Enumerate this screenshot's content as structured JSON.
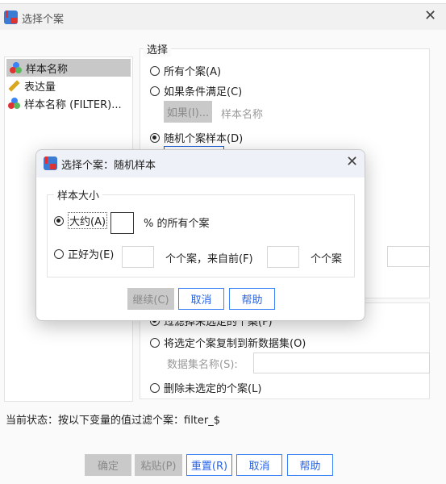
{
  "window": {
    "title": "选择个案"
  },
  "variables": [
    {
      "label": "样本名称",
      "icon": "nominal-icon",
      "selected": true
    },
    {
      "label": "表达量",
      "icon": "scale-ruler-icon",
      "selected": false
    },
    {
      "label": "样本名称 (FILTER)...",
      "icon": "nominal-icon",
      "selected": false
    }
  ],
  "select_group": {
    "label": "选择",
    "all_cases": "所有个案(A)",
    "if_condition": "如果条件满足(C)",
    "if_button": "如果(I)...",
    "if_hint": "样本名称",
    "random_sample": "随机个案样本(D)",
    "selected": "random_sample"
  },
  "output_group": {
    "filter": "过滤掉未选定的个案(F)",
    "copy": "将选定个案复制到新数据集(O)",
    "dataset_label": "数据集名称(S):",
    "dataset_value": "",
    "delete": "删除未选定的个案(L)"
  },
  "status": "当前状态：按以下变量的值过滤个案：filter_$",
  "buttons": {
    "ok": "确定",
    "paste": "粘贴(P)",
    "reset": "重置(R)",
    "cancel": "取消",
    "help": "帮助"
  },
  "dialog": {
    "title": "选择个案：随机样本",
    "group_label": "样本大小",
    "approx_label": "大约(A)",
    "approx_value": "",
    "approx_suffix": "% 的所有个案",
    "exact_label": "正好为(E)",
    "exact_value": "",
    "exact_mid": "个个案，来自前(F)",
    "exact_from_value": "",
    "exact_suffix": "个个案",
    "selected": "approx",
    "buttons": {
      "continue": "继续(C)",
      "cancel": "取消",
      "help": "帮助"
    }
  },
  "colors": {
    "accent": "#3b82f6",
    "disabled": "#c9c9c9"
  }
}
